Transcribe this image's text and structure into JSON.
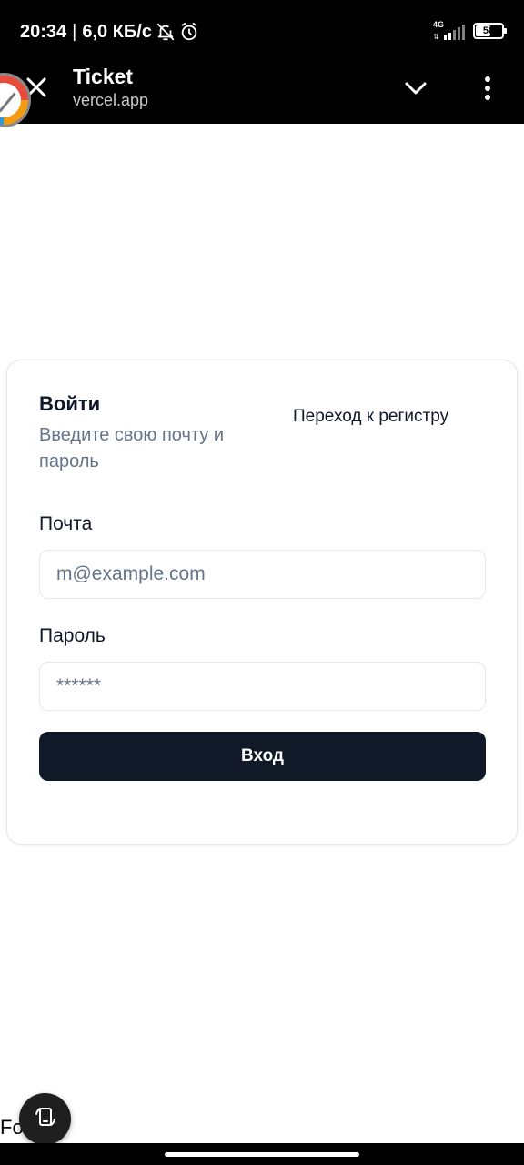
{
  "status_bar": {
    "time": "20:34",
    "separator": "|",
    "speed": "6,0 КБ/с",
    "network": "4G",
    "battery": "58",
    "battery_level": 0.58
  },
  "browser": {
    "title": "Ticket",
    "url": "vercel.app"
  },
  "login_card": {
    "title": "Войти",
    "description": "Введите свою почту и пароль",
    "register_link": "Переход к регистру",
    "email_label": "Почта",
    "email_placeholder": "m@example.com",
    "password_label": "Пароль",
    "password_placeholder": "******",
    "submit_label": "Вход"
  },
  "footer": {
    "text": "Footer"
  },
  "colors": {
    "primary_button": "#111827",
    "muted_text": "#64748b",
    "border": "#e2e8f0"
  },
  "icons": [
    "bell-off-icon",
    "alarm-icon",
    "signal-icon",
    "battery-icon",
    "close-icon",
    "chevron-down-icon",
    "more-vert-icon",
    "rotate-screen-icon"
  ]
}
